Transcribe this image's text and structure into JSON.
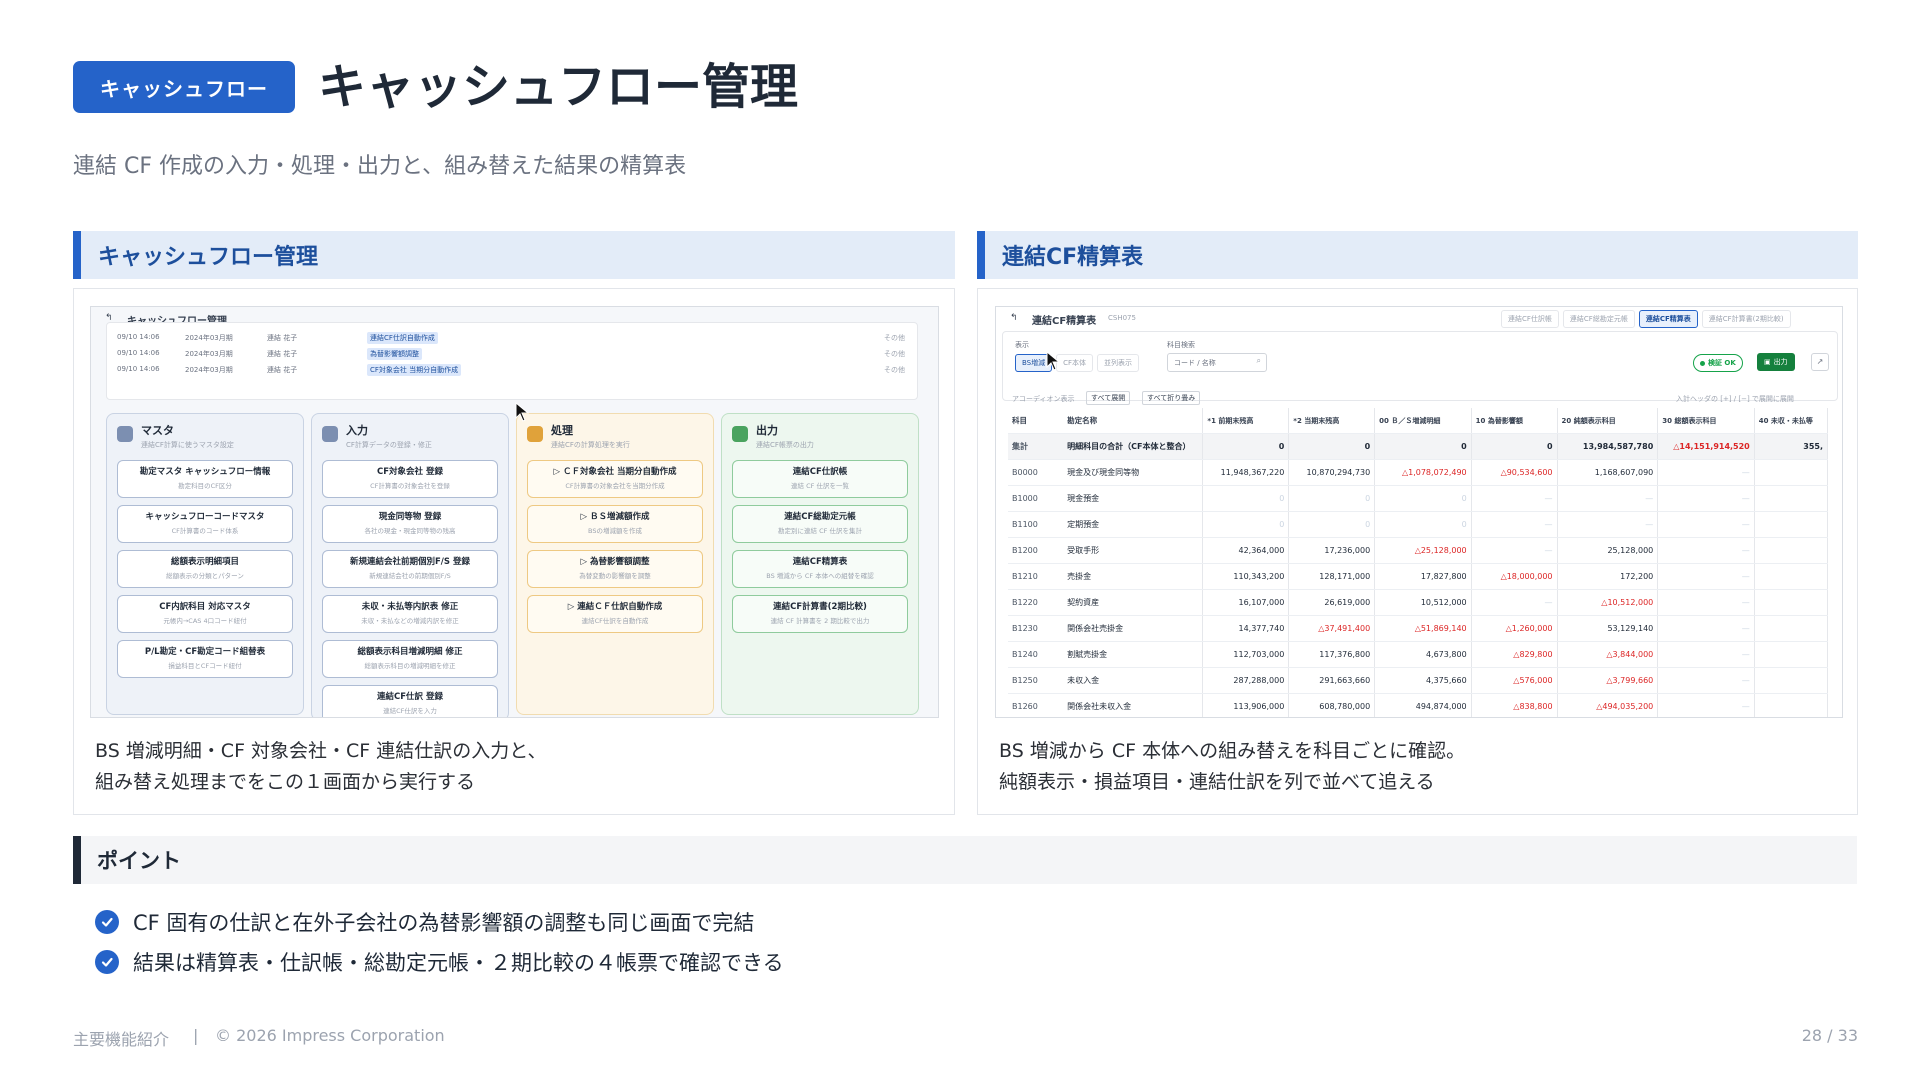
{
  "header": {
    "badge": "キャッシュフロー",
    "title": "キャッシュフロー管理",
    "subtitle": "連結 CF 作成の入力・処理・出力と、組み替えた結果の精算表"
  },
  "left_panel": {
    "heading": "キャッシュフロー管理",
    "caption_line1": "BS 増減明細・CF 対象会社・CF 連結仕訳の入力と、",
    "caption_line2": "組み替え処理までをこの１画面から実行する",
    "screenshot": {
      "title": "キャッシュフロー管理",
      "log_rows": [
        {
          "time": "09/10 14:06",
          "period": "2024年03月期",
          "user": "連結 花子",
          "action": "連結CF仕訳自動作成",
          "more": "その他"
        },
        {
          "time": "09/10 14:06",
          "period": "2024年03月期",
          "user": "連結 花子",
          "action": "為替影響額調整",
          "more": "その他"
        },
        {
          "time": "09/10 14:06",
          "period": "2024年03月期",
          "user": "連結 花子",
          "action": "CF対象会社 当期分自動作成",
          "more": "その他"
        }
      ],
      "columns": [
        {
          "title": "マスタ",
          "sub": "連結CF計算に使うマスタ設定",
          "buttons": [
            {
              "label": "勘定マスタ キャッシュフロー情報",
              "sub": "勘定科目のCF区分"
            },
            {
              "label": "キャッシュフローコードマスタ",
              "sub": "CF計算書のコード体系"
            },
            {
              "label": "総額表示明細項目",
              "sub": "総額表示の分類とパターン"
            },
            {
              "label": "CF内訳科目 対応マスタ",
              "sub": "元帳内→CAS 4口コード紐付"
            },
            {
              "label": "P/L勘定・CF勘定コード組替表",
              "sub": "損益科目とCFコード紐付"
            }
          ]
        },
        {
          "title": "入力",
          "sub": "CF計算データの登録・修正",
          "buttons": [
            {
              "label": "CF対象会社 登録",
              "sub": "CF計算書の対象会社を登録"
            },
            {
              "label": "現金同等物 登録",
              "sub": "各社の現金・現金同等物の残高"
            },
            {
              "label": "新規連結会社前期個別F/S 登録",
              "sub": "新規連結会社の前期個別F/S"
            },
            {
              "label": "未収・未払等内訳表 修正",
              "sub": "未収・未払などの増減内訳を修正"
            },
            {
              "label": "総額表示科目増減明細 修正",
              "sub": "総額表示科目の増減明細を修正"
            },
            {
              "label": "連結CF仕訳 登録",
              "sub": "連結CF仕訳を入力"
            }
          ]
        },
        {
          "title": "処理",
          "sub": "連結CFの計算処理を実行",
          "buttons": [
            {
              "label": "▷ ＣＦ対象会社 当期分自動作成",
              "sub": "CF計算書の対象会社を当期分作成"
            },
            {
              "label": "▷ ＢＳ増減額作成",
              "sub": "BSの増減額を作成"
            },
            {
              "label": "▷ 為替影響額調整",
              "sub": "為替変動の影響額を調整"
            },
            {
              "label": "▷ 連結ＣＦ仕訳自動作成",
              "sub": "連結CF仕訳を自動作成"
            }
          ]
        },
        {
          "title": "出力",
          "sub": "連結CF帳票の出力",
          "buttons": [
            {
              "label": "連結CF仕訳帳",
              "sub": "連結 CF 仕訳を一覧"
            },
            {
              "label": "連結CF総勘定元帳",
              "sub": "勘定別に連結 CF 仕訳を集計"
            },
            {
              "label": "連結CF精算表",
              "sub": "BS 増減から CF 本体への組替を確認"
            },
            {
              "label": "連結CF計算書(2期比較)",
              "sub": "連結 CF 計算書を 2 期比較で出力"
            }
          ]
        }
      ]
    }
  },
  "right_panel": {
    "heading": "連結CF精算表",
    "caption_line1": "BS 増減から CF 本体への組み替えを科目ごとに確認。",
    "caption_line2": "純額表示・損益項目・連結仕訳を列で並べて追える",
    "screenshot": {
      "title": "連結CF精算表",
      "screen_id": "CSH075",
      "tabs": [
        "連結CF仕訳帳",
        "連結CF総勘定元帳",
        "連結CF精算表",
        "連結CF計算書(2期比較)"
      ],
      "display_label": "表示",
      "display_options": [
        "BS増減",
        "CF本体",
        "並列表示"
      ],
      "search_label": "科目検索",
      "search_placeholder": "コード / 名称",
      "status_ok": "検証 OK",
      "export_label": "出力",
      "accordion_label": "アコーディオン表示",
      "expand_all": "すべて展開",
      "collapse_all": "すべて折り畳み",
      "hint": "入計ヘッダの [+] / [−] で展開に展開",
      "columns": [
        "科目",
        "勘定名称",
        "*1 前期末残高",
        "*2 当期末残高",
        "00 Ｂ／Ｓ増減明細",
        "10 為替影響額",
        "20 純額表示科目",
        "30 総額表示科目",
        "40 未収・未払等"
      ],
      "rows": [
        {
          "code": "集計",
          "name": "明細科目の合計（CF本体と整合）",
          "v": [
            "0",
            "0",
            "0",
            "0",
            "13,984,587,780",
            "△14,151,914,520",
            "355,"
          ]
        },
        {
          "code": "B0000",
          "name": "現金及び現金同等物",
          "v": [
            "11,948,367,220",
            "10,870,294,730",
            "△1,078,072,490",
            "△90,534,600",
            "1,168,607,090",
            "—",
            ""
          ]
        },
        {
          "code": "B1000",
          "name": "現金預金",
          "v": [
            "0",
            "0",
            "0",
            "—",
            "—",
            "—",
            ""
          ]
        },
        {
          "code": "B1100",
          "name": "定期預金",
          "v": [
            "0",
            "0",
            "0",
            "—",
            "—",
            "—",
            ""
          ]
        },
        {
          "code": "B1200",
          "name": "受取手形",
          "v": [
            "42,364,000",
            "17,236,000",
            "△25,128,000",
            "—",
            "25,128,000",
            "—",
            ""
          ]
        },
        {
          "code": "B1210",
          "name": "売掛金",
          "v": [
            "110,343,200",
            "128,171,000",
            "17,827,800",
            "△18,000,000",
            "172,200",
            "—",
            ""
          ]
        },
        {
          "code": "B1220",
          "name": "契約資産",
          "v": [
            "16,107,000",
            "26,619,000",
            "10,512,000",
            "—",
            "△10,512,000",
            "—",
            ""
          ]
        },
        {
          "code": "B1230",
          "name": "関係会社売掛金",
          "v": [
            "14,377,740",
            "△37,491,400",
            "△51,869,140",
            "△1,260,000",
            "53,129,140",
            "—",
            ""
          ]
        },
        {
          "code": "B1240",
          "name": "割賦売掛金",
          "v": [
            "112,703,000",
            "117,376,800",
            "4,673,800",
            "△829,800",
            "△3,844,000",
            "—",
            ""
          ]
        },
        {
          "code": "B1250",
          "name": "未収入金",
          "v": [
            "287,288,000",
            "291,663,660",
            "4,375,660",
            "△576,000",
            "△3,799,660",
            "—",
            ""
          ]
        },
        {
          "code": "B1260",
          "name": "関係会社未収入金",
          "v": [
            "113,906,000",
            "608,780,000",
            "494,874,000",
            "△838,800",
            "△494,035,200",
            "—",
            ""
          ]
        }
      ]
    }
  },
  "points": {
    "heading": "ポイント",
    "items": [
      "CF 固有の仕訳と在外子会社の為替影響額の調整も同じ画面で完結",
      "結果は精算表・仕訳帳・総勘定元帳・２期比較の４帳票で確認できる"
    ]
  },
  "footer": {
    "section": "主要機能紹介",
    "separator": "|",
    "copyright": "© 2026 Impress Corporation",
    "page": "28 / 33"
  },
  "colors": {
    "accent": "#2563c9",
    "negative": "#dc2626",
    "ok": "#16a34a"
  }
}
